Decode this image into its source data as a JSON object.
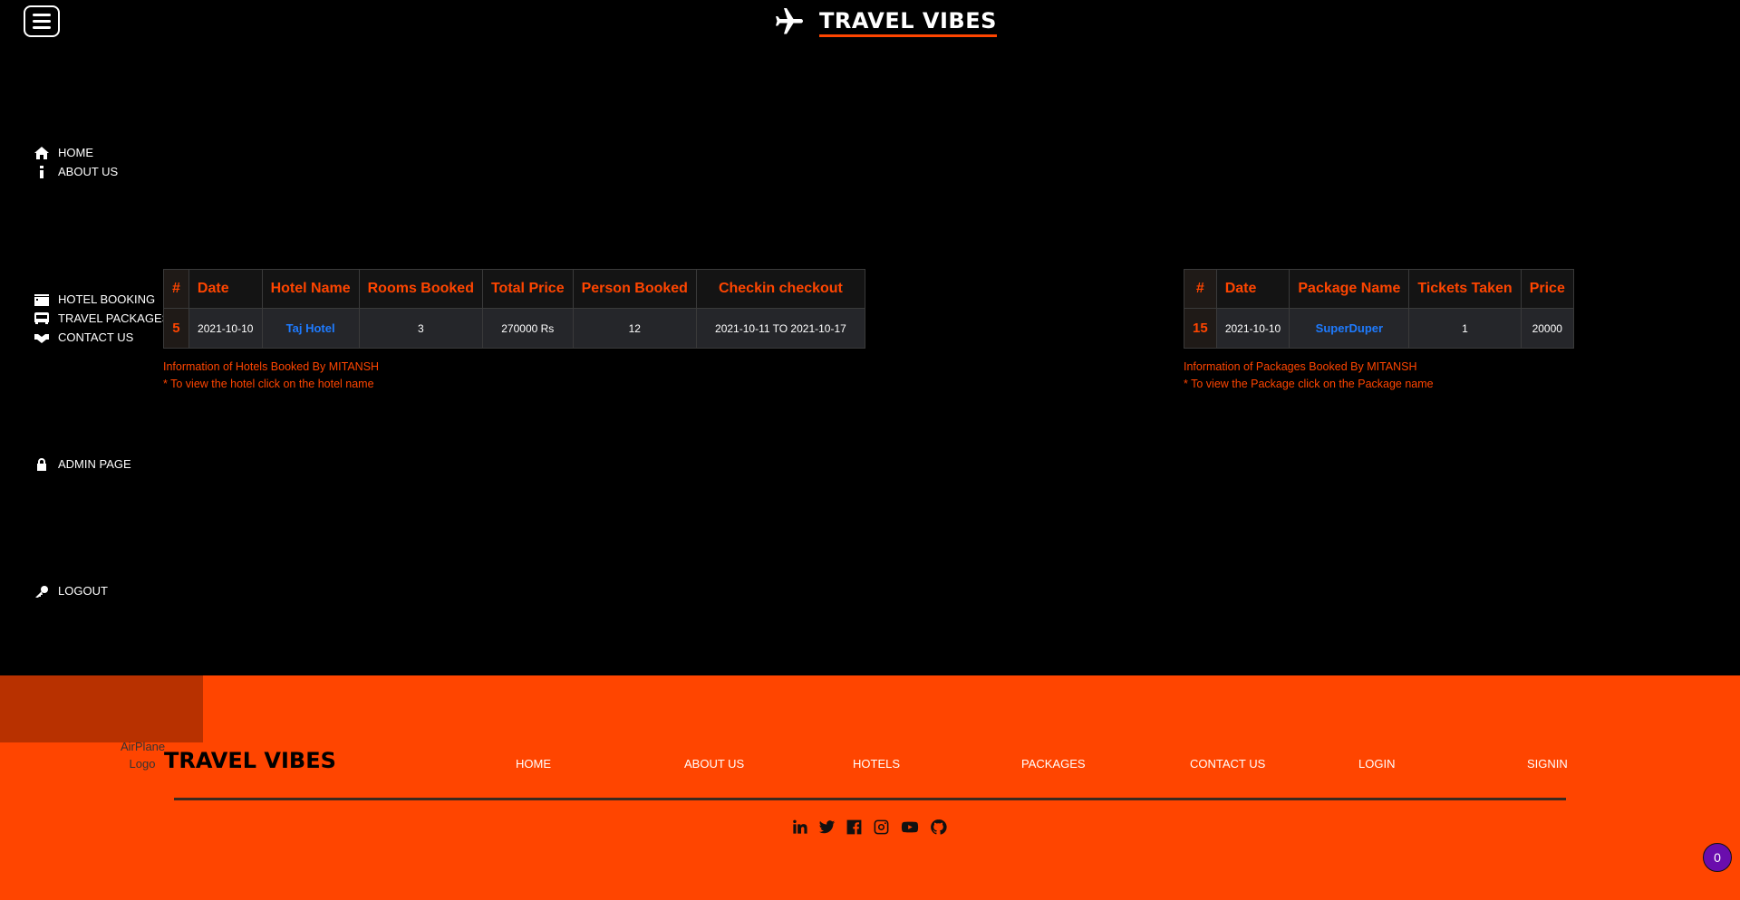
{
  "header": {
    "title": "TRAVEL VIBES",
    "menu_icon": "hamburger-icon",
    "logo_icon": "airplane-icon"
  },
  "sidebar": {
    "group1": [
      {
        "label": "HOME",
        "icon": "home-icon"
      },
      {
        "label": "ABOUT US",
        "icon": "info-icon"
      }
    ],
    "group2": [
      {
        "label": "HOTEL BOOKING",
        "icon": "hotel-icon"
      },
      {
        "label": "TRAVEL PACKAGES",
        "icon": "bus-icon"
      },
      {
        "label": "CONTACT US",
        "icon": "handshake-icon"
      }
    ],
    "admin": {
      "label": "ADMIN PAGE",
      "icon": "lock-icon"
    },
    "logout": {
      "label": "LOGOUT",
      "icon": "key-icon"
    }
  },
  "hotels": {
    "headers": [
      "#",
      "Date",
      "Hotel Name",
      "Rooms Booked",
      "Total Price",
      "Person Booked",
      "Checkin checkout"
    ],
    "rows": [
      {
        "id": "5",
        "date": "2021-10-10",
        "hotel": "Taj Hotel",
        "rooms": "3",
        "price": "270000 Rs",
        "persons": "12",
        "checkin": "2021-10-11 TO 2021-10-17"
      }
    ],
    "note1": "Information of Hotels Booked By MITANSH",
    "note2": "* To view the hotel click on the hotel name"
  },
  "packages": {
    "headers": [
      "#",
      "Date",
      "Package Name",
      "Tickets Taken",
      "Price"
    ],
    "rows": [
      {
        "id": "15",
        "date": "2021-10-10",
        "package": "SuperDuper",
        "tickets": "1",
        "price": "20000"
      }
    ],
    "note1": "Information of Packages Booked By MITANSH",
    "note2": "* To view the Package click on the Package name"
  },
  "footer": {
    "logo_alt": "AirPlane Logo",
    "title": "TRAVEL VIBES",
    "nav": [
      "HOME",
      "ABOUT US",
      "HOTELS",
      "PACKAGES",
      "CONTACT US",
      "LOGIN",
      "SIGNIN"
    ],
    "social": [
      "linkedin-icon",
      "twitter-icon",
      "facebook-icon",
      "instagram-icon",
      "youtube-icon",
      "github-icon"
    ]
  },
  "badge": {
    "count": "0"
  },
  "colors": {
    "accent": "#ff4500",
    "link": "#1e7bff",
    "background": "#000000",
    "badge": "#6a0dad"
  }
}
